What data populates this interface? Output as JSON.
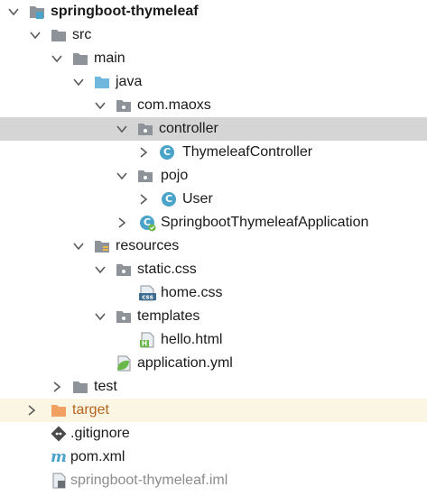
{
  "tree": {
    "root": {
      "label": "springboot-thymeleaf"
    },
    "src": {
      "label": "src"
    },
    "main": {
      "label": "main"
    },
    "java": {
      "label": "java"
    },
    "package": {
      "label": "com.maoxs"
    },
    "controller": {
      "label": "controller"
    },
    "thymeleaf_controller": {
      "label": "ThymeleafController"
    },
    "pojo": {
      "label": "pojo"
    },
    "user": {
      "label": "User"
    },
    "application_class": {
      "label": "SpringbootThymeleafApplication"
    },
    "resources": {
      "label": "resources"
    },
    "static_css": {
      "label": "static.css"
    },
    "home_css": {
      "label": "home.css"
    },
    "templates": {
      "label": "templates"
    },
    "hello_html": {
      "label": "hello.html"
    },
    "application_yml": {
      "label": "application.yml"
    },
    "test": {
      "label": "test"
    },
    "target": {
      "label": "target"
    },
    "gitignore": {
      "label": ".gitignore"
    },
    "pom": {
      "label": "pom.xml"
    },
    "iml": {
      "label": "springboot-thymeleaf.iml"
    }
  },
  "icons": {
    "class_letter": "C",
    "css_badge": "css",
    "html_badge": "H",
    "maven_letter": "m"
  },
  "colors": {
    "selection": "#d5d5d5",
    "excluded_bg": "#fbf6e3",
    "folder": "#8e9399",
    "source_folder": "#6fb7dd",
    "excluded_folder": "#f0a060",
    "class_icon": "#4aa3c8",
    "spring_green": "#6bb84a"
  }
}
